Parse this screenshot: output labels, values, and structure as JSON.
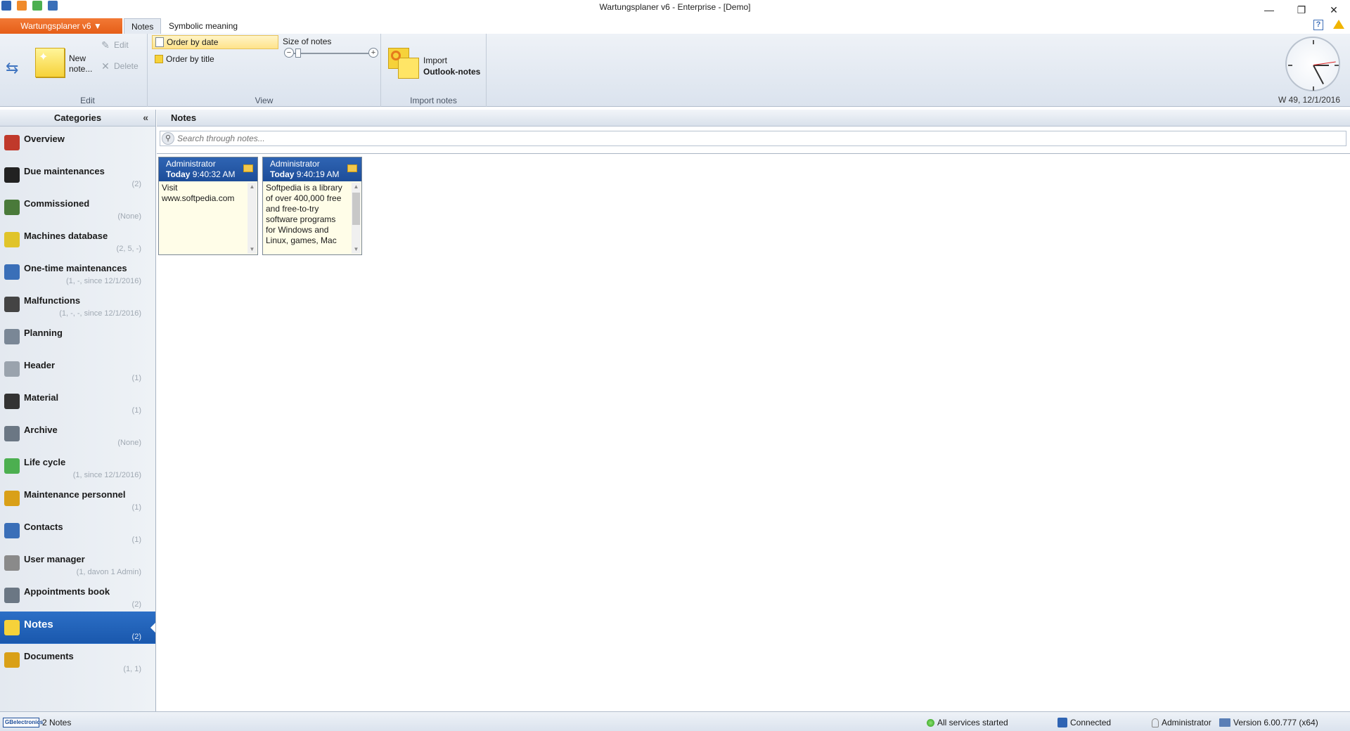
{
  "window": {
    "title": "Wartungsplaner v6 - Enterprise - [Demo]",
    "controls": {
      "minimize": "—",
      "maximize": "❐",
      "close": "✕"
    }
  },
  "ribbon_tabs": {
    "app_menu": "Wartungsplaner v6 ▼",
    "tabs": [
      "Notes",
      "Symbolic meaning"
    ],
    "help": "?"
  },
  "ribbon": {
    "edit_group": {
      "label": "Edit",
      "new_note": "New\nnote...",
      "edit": "Edit",
      "delete": "Delete"
    },
    "view_group": {
      "label": "View",
      "order_by_date": "Order by date",
      "order_by_title": "Order by title",
      "size_label": "Size of notes"
    },
    "import_group": {
      "label": "Import notes",
      "import_line1": "Import",
      "import_line2": "Outlook-notes"
    },
    "clock_date": "W 49, 12/1/2016"
  },
  "sidebar": {
    "title": "Categories",
    "collapse": "«",
    "items": [
      {
        "name": "Overview",
        "count": "",
        "color": "#c0392b"
      },
      {
        "name": "Due maintenances",
        "count": "(2)",
        "color": "#222222"
      },
      {
        "name": "Commissioned",
        "count": "(None)",
        "color": "#4a7a3a"
      },
      {
        "name": "Machines database",
        "count": "(2, 5, -)",
        "color": "#e0c42a"
      },
      {
        "name": "One-time maintenances",
        "count": "(1, -, since 12/1/2016)",
        "color": "#3a6fb8"
      },
      {
        "name": "Malfunctions",
        "count": "(1, -, -, since 12/1/2016)",
        "color": "#444444"
      },
      {
        "name": "Planning",
        "count": "",
        "color": "#7a8796"
      },
      {
        "name": "Header",
        "count": "(1)",
        "color": "#9aa3ad"
      },
      {
        "name": "Material",
        "count": "(1)",
        "color": "#333333"
      },
      {
        "name": "Archive",
        "count": "(None)",
        "color": "#6b7784"
      },
      {
        "name": "Life cycle",
        "count": "(1, since 12/1/2016)",
        "color": "#4caf50"
      },
      {
        "name": "Maintenance personnel",
        "count": "(1)",
        "color": "#d9a018"
      },
      {
        "name": "Contacts",
        "count": "(1)",
        "color": "#3a6fb8"
      },
      {
        "name": "User manager",
        "count": "(1, davon 1 Admin)",
        "color": "#8a8a8a"
      },
      {
        "name": "Appointments book",
        "count": "(2)",
        "color": "#6b7784"
      },
      {
        "name": "Notes",
        "count": "(2)",
        "color": "#f6d23a",
        "active": true
      },
      {
        "name": "Documents",
        "count": "(1, 1)",
        "color": "#d9a018"
      }
    ]
  },
  "main": {
    "title": "Notes",
    "search_placeholder": "Search through notes...",
    "notes": [
      {
        "author": "Administrator",
        "day": "Today",
        "time": "9:40:32 AM",
        "text": "Visit\nwww.softpedia.com"
      },
      {
        "author": "Administrator",
        "day": "Today",
        "time": "9:40:19 AM",
        "text": "Softpedia is a library\nof over 400,000 free\nand free-to-try\nsoftware programs\nfor Windows and\nLinux, games, Mac"
      }
    ]
  },
  "statusbar": {
    "logo": "GBelectronics",
    "notes_count": "2 Notes",
    "services": "All services started",
    "connection": "Connected",
    "user": "Administrator",
    "version": "Version 6.00.777 (x64)"
  }
}
